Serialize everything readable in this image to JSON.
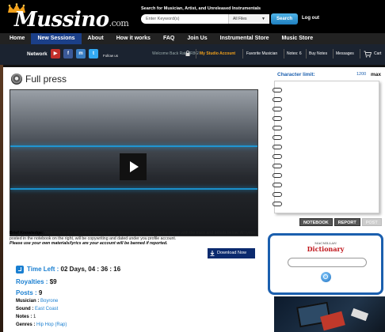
{
  "header": {
    "brand": "Mussino",
    "brand_suffix": ".com",
    "search_label": "Search for Musician, Artist, and Unreleased Instrumentals",
    "search_placeholder": "Enter Keyword(s)",
    "search_filter": "All Files",
    "search_button": "Search",
    "logout": "Log out"
  },
  "main_nav": [
    {
      "label": "Home"
    },
    {
      "label": "New Sessions"
    },
    {
      "label": "About"
    },
    {
      "label": "How it works"
    },
    {
      "label": "FAQ"
    },
    {
      "label": "Join Us"
    },
    {
      "label": "Instrumental Store"
    },
    {
      "label": "Music Store"
    }
  ],
  "subbar": {
    "network": "Network",
    "follow_us": "Follow us",
    "welcome": "Welcome Back RatedR8G!",
    "studio_account": "My Studio Account",
    "favorite_musician": "Favorite Musician",
    "notes": "Notes: 6",
    "buy_notes": "Buy Notes",
    "messages": "Messages",
    "cart": "Cart"
  },
  "session": {
    "title": "Full press",
    "brief_label": "Brief Knowledge:",
    "brief_text": "Welcome to the recording session area. Above you will see a media player with the track and details below. All lyrics posted in the notebook on the right, will be copywriting and dated under you profile account.",
    "warning": "Please use your own materials/lyrics are your account will be banned if reported.",
    "download_button": "Download Now"
  },
  "stats": {
    "time_left_label": "Time Left :",
    "time_left_value": "02 Days, 04 : 36 : 16",
    "royalties_label": "Royalties :",
    "royalties_value": "$9",
    "posts_label": "Posts :",
    "posts_value": "9",
    "musician_label": "Musician :",
    "musician_value": "Boyrone",
    "sound_label": "Sound :",
    "sound_value": "East Coast",
    "notes_label": "Notes :",
    "notes_value": "1",
    "genres_label": "Genres :",
    "genres_value": "Hip Hop (Rap)"
  },
  "notebook": {
    "char_limit_label": "Character limit:",
    "char_limit_value": "1200",
    "char_limit_max": "max",
    "tabs": [
      {
        "label": "NOTEBOOK",
        "enabled": true
      },
      {
        "label": "REPORT",
        "enabled": true
      },
      {
        "label": "POST",
        "enabled": false
      }
    ]
  },
  "dictionary": {
    "publisher": "MACMILLAN",
    "name": "Dictionary"
  },
  "colors": {
    "accent_blue": "#1a7fd1",
    "nav_active": "#1b3f88",
    "studio_orange": "#f2a11b",
    "dictionary_red": "#c0151b"
  }
}
